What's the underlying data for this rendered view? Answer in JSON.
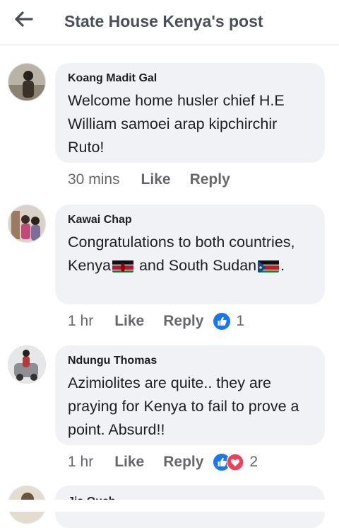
{
  "header": {
    "back_icon": "arrow-left-icon",
    "title": "State House Kenya's post"
  },
  "comments": [
    {
      "author": "Koang Madit Gal",
      "text": "Welcome home husler chief H.E William samoei arap kipchirchir Ruto!",
      "time": "30 mins",
      "like": "Like",
      "reply": "Reply",
      "reactions": []
    },
    {
      "author": "Kawai Chap",
      "text_a": "Congratulations to both countries, Kenya",
      "text_b": " and South Sudan",
      "text_c": ".",
      "time": "1 hr",
      "like": "Like",
      "reply": "Reply",
      "reactions": [
        "like"
      ],
      "reaction_count": "1"
    },
    {
      "author": "Ndungu Thomas",
      "text": "Azimiolites are quite.. they are praying for Kenya to fail to prove a point.  Absurd!!",
      "time": "1 hr",
      "like": "Like",
      "reply": "Reply",
      "reactions": [
        "like",
        "love"
      ],
      "reaction_count": "2"
    },
    {
      "author": "Jia Ouch"
    }
  ],
  "colors": {
    "bubble": "#f0f2f5",
    "meta": "#65676b",
    "like_blue": "#1877f2",
    "love_red": "#f33e58"
  }
}
